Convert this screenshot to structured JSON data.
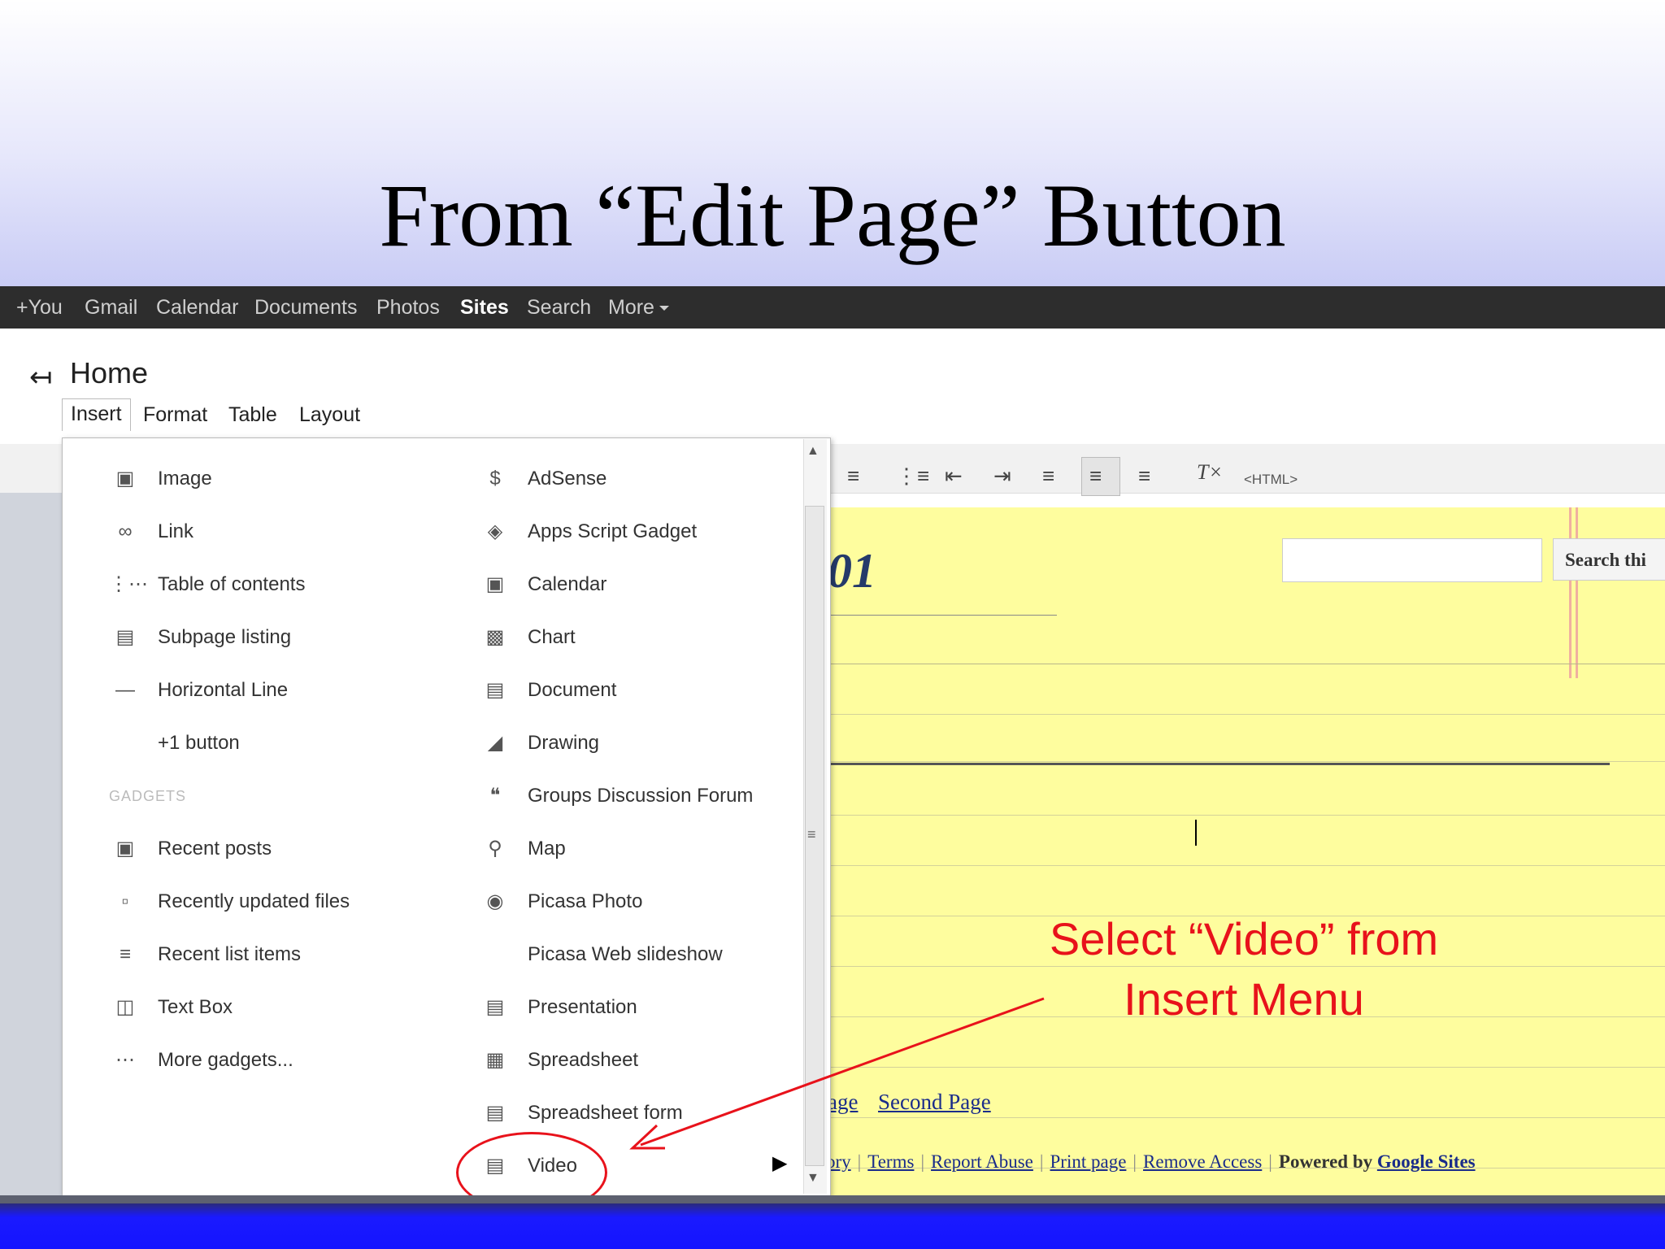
{
  "slide": {
    "title": "From “Edit Page” Button",
    "annotation_line1": "Select “Video” from",
    "annotation_line2": "Insert Menu"
  },
  "topbar": {
    "items": [
      "+You",
      "Gmail",
      "Calendar",
      "Documents",
      "Photos",
      "Sites",
      "Search",
      "More"
    ],
    "active": "Sites"
  },
  "page": {
    "title": "Home"
  },
  "menubar": {
    "tabs": [
      "Insert",
      "Format",
      "Table",
      "Layout"
    ]
  },
  "toolbar": {
    "html_label": "<HTML>"
  },
  "insert_menu": {
    "left_column": [
      "Image",
      "Link",
      "Table of contents",
      "Subpage listing",
      "Horizontal Line",
      "+1 button"
    ],
    "section_label": "GADGETS",
    "gadgets": [
      "Recent posts",
      "Recently updated files",
      "Recent list items",
      "Text Box",
      "More gadgets..."
    ],
    "right_column": [
      "AdSense",
      "Apps Script Gadget",
      "Calendar",
      "Chart",
      "Document",
      "Drawing",
      "Groups Discussion Forum",
      "Map",
      "Picasa Photo",
      "Picasa Web slideshow",
      "Presentation",
      "Spreadsheet",
      "Spreadsheet form",
      "Video"
    ]
  },
  "editor": {
    "heading_fragment": "01",
    "search_button": "Search thi",
    "nav_link_1": "age",
    "nav_link_2": "Second Page",
    "footer": {
      "link_1": "ory",
      "link_2": "Terms",
      "link_3": "Report Abuse",
      "link_4": "Print page",
      "link_5": "Remove Access",
      "powered_by": "Powered by",
      "google_sites": "Google Sites"
    }
  },
  "colors": {
    "annotation": "#e8121b",
    "editor_background": "#fefd9e",
    "topbar": "#2d2d2d"
  }
}
